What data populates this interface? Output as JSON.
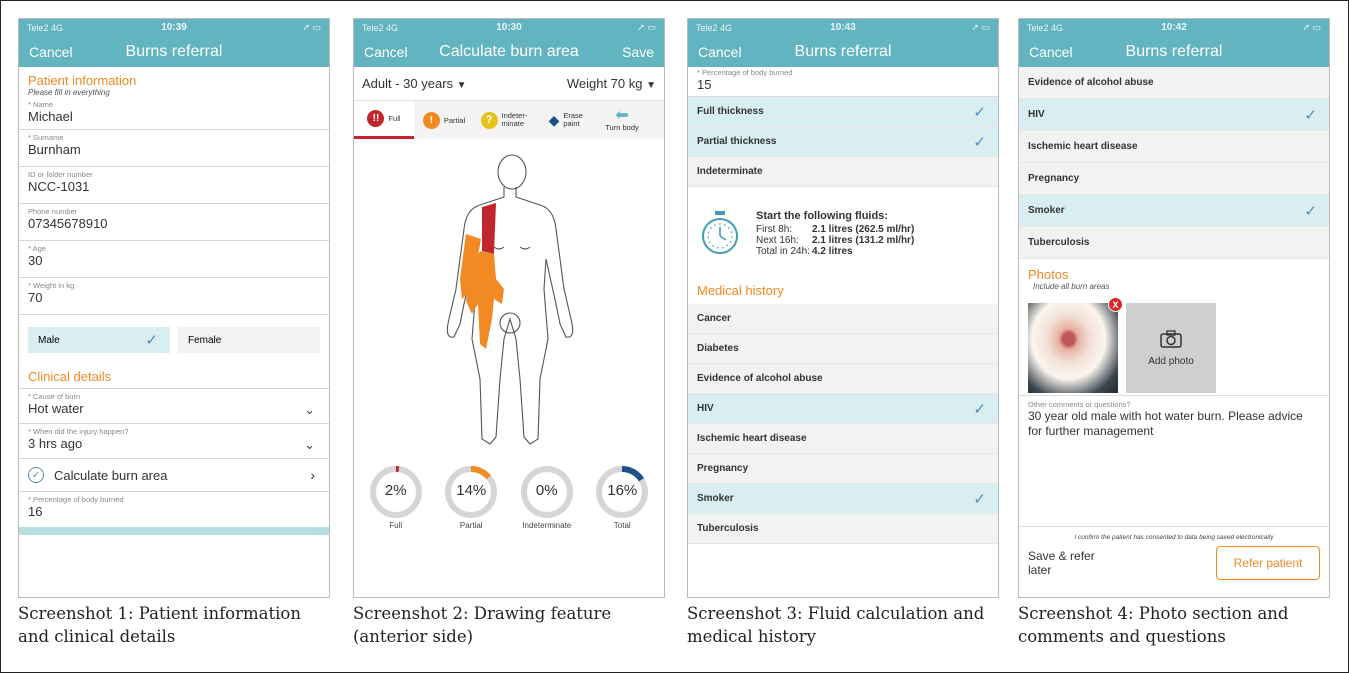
{
  "screen1": {
    "status": {
      "carrier": "Tele2 4G",
      "time": "10:39"
    },
    "nav": {
      "cancel": "Cancel",
      "title": "Burns referral"
    },
    "patient_info_title": "Patient information",
    "hint": "Please fill in everything",
    "fields": [
      {
        "label": "* Name",
        "value": "Michael"
      },
      {
        "label": "* Surname",
        "value": "Burnham"
      },
      {
        "label": "ID or folder number",
        "value": "NCC-1031"
      },
      {
        "label": "Phone number",
        "value": "07345678910"
      },
      {
        "label": "* Age",
        "value": "30"
      },
      {
        "label": "* Weight in kg",
        "value": "70"
      }
    ],
    "gender": {
      "male": "Male",
      "female": "Female"
    },
    "clinical_title": "Clinical details",
    "cause": {
      "label": "* Cause of burn",
      "value": "Hot water"
    },
    "when": {
      "label": "* When did the injury happen?",
      "value": "3 hrs ago"
    },
    "calc": "Calculate burn area",
    "percent": {
      "label": "* Percentage of body burned",
      "value": "16"
    }
  },
  "screen2": {
    "status": {
      "carrier": "Tele2 4G",
      "time": "10:30"
    },
    "nav": {
      "cancel": "Cancel",
      "title": "Calculate burn area",
      "save": "Save"
    },
    "age": "Adult - 30 years",
    "weight": "Weight 70 kg",
    "tools": {
      "full": "Full",
      "partial": "Partial",
      "indeterminate": "Indeter-minate",
      "erase": "Erase paint",
      "turn": "Turn body"
    },
    "gauges": [
      {
        "label": "Full",
        "value": "2%",
        "fraction": 0.02,
        "color": "#c0262c"
      },
      {
        "label": "Partial",
        "value": "14%",
        "fraction": 0.14,
        "color": "#f28a23"
      },
      {
        "label": "Indeterminate",
        "value": "0%",
        "fraction": 0,
        "color": "#e8c21a"
      },
      {
        "label": "Total",
        "value": "16%",
        "fraction": 0.16,
        "color": "#1f4f87"
      }
    ]
  },
  "screen3": {
    "status": {
      "carrier": "Tele2 4G",
      "time": "10:43"
    },
    "nav": {
      "cancel": "Cancel",
      "title": "Burns referral"
    },
    "percent": {
      "label": "* Percentage of body burned",
      "value": "15"
    },
    "depth": [
      {
        "label": "Full thickness",
        "selected": true
      },
      {
        "label": "Partial thickness",
        "selected": true
      },
      {
        "label": "Indeterminate",
        "selected": false
      }
    ],
    "fluids": {
      "title": "Start the following fluids:",
      "rows": [
        {
          "k": "First 8h:",
          "v": "2.1 litres (262.5 ml/hr)"
        },
        {
          "k": "Next 16h:",
          "v": "2.1 litres (131.2 ml/hr)"
        },
        {
          "k": "Total in 24h:",
          "v": "4.2 litres"
        }
      ]
    },
    "history_title": "Medical history",
    "history": [
      {
        "label": "Cancer",
        "selected": false
      },
      {
        "label": "Diabetes",
        "selected": false
      },
      {
        "label": "Evidence of alcohol abuse",
        "selected": false
      },
      {
        "label": "HIV",
        "selected": true
      },
      {
        "label": "Ischemic heart disease",
        "selected": false
      },
      {
        "label": "Pregnancy",
        "selected": false
      },
      {
        "label": "Smoker",
        "selected": true
      },
      {
        "label": "Tuberculosis",
        "selected": false
      }
    ]
  },
  "screen4": {
    "status": {
      "carrier": "Tele2 4G",
      "time": "10:42"
    },
    "nav": {
      "cancel": "Cancel",
      "title": "Burns referral"
    },
    "history": [
      {
        "label": "Evidence of alcohol abuse",
        "selected": false
      },
      {
        "label": "HIV",
        "selected": true
      },
      {
        "label": "Ischemic heart disease",
        "selected": false
      },
      {
        "label": "Pregnancy",
        "selected": false
      },
      {
        "label": "Smoker",
        "selected": true
      },
      {
        "label": "Tuberculosis",
        "selected": false
      }
    ],
    "photos_title": "Photos",
    "photos_hint": "Include all burn areas",
    "photo_remove": "X",
    "add_photo": "Add photo",
    "comments_label": "Other comments or questions?",
    "comments_value": "30 year old male with hot water burn. Please advice for further management",
    "consent": "I confirm the patient has consented to data being saved electronically",
    "save_later": "Save & refer later",
    "refer": "Refer patient"
  },
  "captions": [
    "Screenshot 1: Patient information and clinical details",
    "Screenshot 2: Drawing feature (anterior side)",
    "Screenshot 3: Fluid calculation and medical history",
    "Screenshot 4: Photo section and comments and questions"
  ],
  "colors": {
    "teal": "#62b4c0",
    "orange": "#f08a24",
    "selected": "#d8eef0",
    "tick": "#4b8fc4"
  }
}
